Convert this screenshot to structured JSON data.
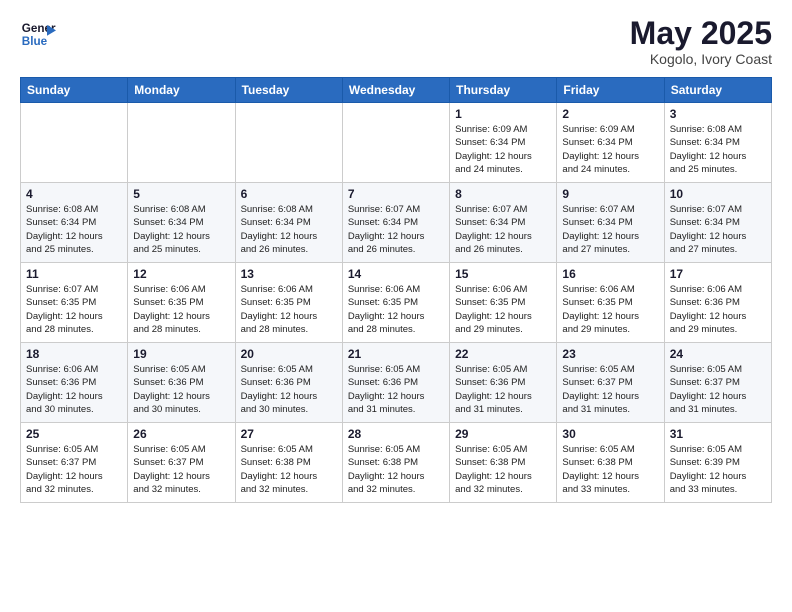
{
  "header": {
    "logo_line1": "General",
    "logo_line2": "Blue",
    "month_year": "May 2025",
    "location": "Kogolo, Ivory Coast"
  },
  "days_of_week": [
    "Sunday",
    "Monday",
    "Tuesday",
    "Wednesday",
    "Thursday",
    "Friday",
    "Saturday"
  ],
  "weeks": [
    [
      {
        "day": "",
        "info": ""
      },
      {
        "day": "",
        "info": ""
      },
      {
        "day": "",
        "info": ""
      },
      {
        "day": "",
        "info": ""
      },
      {
        "day": "1",
        "info": "Sunrise: 6:09 AM\nSunset: 6:34 PM\nDaylight: 12 hours\nand 24 minutes."
      },
      {
        "day": "2",
        "info": "Sunrise: 6:09 AM\nSunset: 6:34 PM\nDaylight: 12 hours\nand 24 minutes."
      },
      {
        "day": "3",
        "info": "Sunrise: 6:08 AM\nSunset: 6:34 PM\nDaylight: 12 hours\nand 25 minutes."
      }
    ],
    [
      {
        "day": "4",
        "info": "Sunrise: 6:08 AM\nSunset: 6:34 PM\nDaylight: 12 hours\nand 25 minutes."
      },
      {
        "day": "5",
        "info": "Sunrise: 6:08 AM\nSunset: 6:34 PM\nDaylight: 12 hours\nand 25 minutes."
      },
      {
        "day": "6",
        "info": "Sunrise: 6:08 AM\nSunset: 6:34 PM\nDaylight: 12 hours\nand 26 minutes."
      },
      {
        "day": "7",
        "info": "Sunrise: 6:07 AM\nSunset: 6:34 PM\nDaylight: 12 hours\nand 26 minutes."
      },
      {
        "day": "8",
        "info": "Sunrise: 6:07 AM\nSunset: 6:34 PM\nDaylight: 12 hours\nand 26 minutes."
      },
      {
        "day": "9",
        "info": "Sunrise: 6:07 AM\nSunset: 6:34 PM\nDaylight: 12 hours\nand 27 minutes."
      },
      {
        "day": "10",
        "info": "Sunrise: 6:07 AM\nSunset: 6:34 PM\nDaylight: 12 hours\nand 27 minutes."
      }
    ],
    [
      {
        "day": "11",
        "info": "Sunrise: 6:07 AM\nSunset: 6:35 PM\nDaylight: 12 hours\nand 28 minutes."
      },
      {
        "day": "12",
        "info": "Sunrise: 6:06 AM\nSunset: 6:35 PM\nDaylight: 12 hours\nand 28 minutes."
      },
      {
        "day": "13",
        "info": "Sunrise: 6:06 AM\nSunset: 6:35 PM\nDaylight: 12 hours\nand 28 minutes."
      },
      {
        "day": "14",
        "info": "Sunrise: 6:06 AM\nSunset: 6:35 PM\nDaylight: 12 hours\nand 28 minutes."
      },
      {
        "day": "15",
        "info": "Sunrise: 6:06 AM\nSunset: 6:35 PM\nDaylight: 12 hours\nand 29 minutes."
      },
      {
        "day": "16",
        "info": "Sunrise: 6:06 AM\nSunset: 6:35 PM\nDaylight: 12 hours\nand 29 minutes."
      },
      {
        "day": "17",
        "info": "Sunrise: 6:06 AM\nSunset: 6:36 PM\nDaylight: 12 hours\nand 29 minutes."
      }
    ],
    [
      {
        "day": "18",
        "info": "Sunrise: 6:06 AM\nSunset: 6:36 PM\nDaylight: 12 hours\nand 30 minutes."
      },
      {
        "day": "19",
        "info": "Sunrise: 6:05 AM\nSunset: 6:36 PM\nDaylight: 12 hours\nand 30 minutes."
      },
      {
        "day": "20",
        "info": "Sunrise: 6:05 AM\nSunset: 6:36 PM\nDaylight: 12 hours\nand 30 minutes."
      },
      {
        "day": "21",
        "info": "Sunrise: 6:05 AM\nSunset: 6:36 PM\nDaylight: 12 hours\nand 31 minutes."
      },
      {
        "day": "22",
        "info": "Sunrise: 6:05 AM\nSunset: 6:36 PM\nDaylight: 12 hours\nand 31 minutes."
      },
      {
        "day": "23",
        "info": "Sunrise: 6:05 AM\nSunset: 6:37 PM\nDaylight: 12 hours\nand 31 minutes."
      },
      {
        "day": "24",
        "info": "Sunrise: 6:05 AM\nSunset: 6:37 PM\nDaylight: 12 hours\nand 31 minutes."
      }
    ],
    [
      {
        "day": "25",
        "info": "Sunrise: 6:05 AM\nSunset: 6:37 PM\nDaylight: 12 hours\nand 32 minutes."
      },
      {
        "day": "26",
        "info": "Sunrise: 6:05 AM\nSunset: 6:37 PM\nDaylight: 12 hours\nand 32 minutes."
      },
      {
        "day": "27",
        "info": "Sunrise: 6:05 AM\nSunset: 6:38 PM\nDaylight: 12 hours\nand 32 minutes."
      },
      {
        "day": "28",
        "info": "Sunrise: 6:05 AM\nSunset: 6:38 PM\nDaylight: 12 hours\nand 32 minutes."
      },
      {
        "day": "29",
        "info": "Sunrise: 6:05 AM\nSunset: 6:38 PM\nDaylight: 12 hours\nand 32 minutes."
      },
      {
        "day": "30",
        "info": "Sunrise: 6:05 AM\nSunset: 6:38 PM\nDaylight: 12 hours\nand 33 minutes."
      },
      {
        "day": "31",
        "info": "Sunrise: 6:05 AM\nSunset: 6:39 PM\nDaylight: 12 hours\nand 33 minutes."
      }
    ]
  ]
}
